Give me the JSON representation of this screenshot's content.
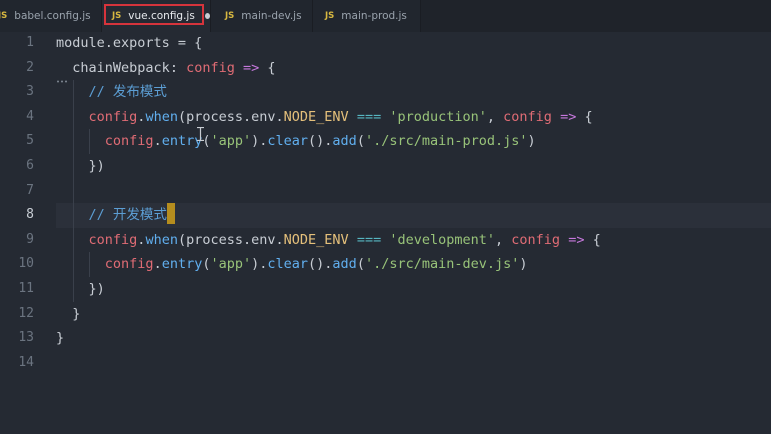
{
  "tabs": [
    {
      "js_badge": "JS",
      "label": "babel.config.js",
      "modified": false,
      "active": false
    },
    {
      "js_badge": "JS",
      "label": "vue.config.js",
      "modified": true,
      "active": true
    },
    {
      "js_badge": "JS",
      "label": "main-dev.js",
      "modified": false,
      "active": false
    },
    {
      "js_badge": "JS",
      "label": "main-prod.js",
      "modified": false,
      "active": false
    }
  ],
  "code": {
    "current_line": 8,
    "lines": [
      {
        "n": "1"
      },
      {
        "n": "2"
      },
      {
        "n": "3"
      },
      {
        "n": "4"
      },
      {
        "n": "5"
      },
      {
        "n": "6"
      },
      {
        "n": "7"
      },
      {
        "n": "8"
      },
      {
        "n": "9"
      },
      {
        "n": "10"
      },
      {
        "n": "11"
      },
      {
        "n": "12"
      },
      {
        "n": "13"
      },
      {
        "n": "14"
      }
    ],
    "tokens": {
      "module": "module",
      "exports": ".exports = {",
      "chainWebpack": "chainWebpack",
      "colon": ":",
      "config": "config",
      "arrow": "=>",
      "brace_open": "{",
      "comment_prod": "// 发布模式",
      "comment_dev": "// 开发模式",
      "dot": ".",
      "when": "when",
      "paren_open": "(",
      "process_env": "process.env.",
      "node_env": "NODE_ENV",
      "strict_eq": "===",
      "production": "'production'",
      "development": "'development'",
      "comma": ",",
      "entry": "entry",
      "app": "'app'",
      "clear": "clear",
      "add": "add",
      "empty_call_dot": "().",
      "close_paren_dot": ").",
      "prod_path": "'./src/main-prod.js'",
      "dev_path": "'./src/main-dev.js'",
      "paren_close": ")",
      "close_when": "})",
      "close_brace": "}"
    }
  }
}
